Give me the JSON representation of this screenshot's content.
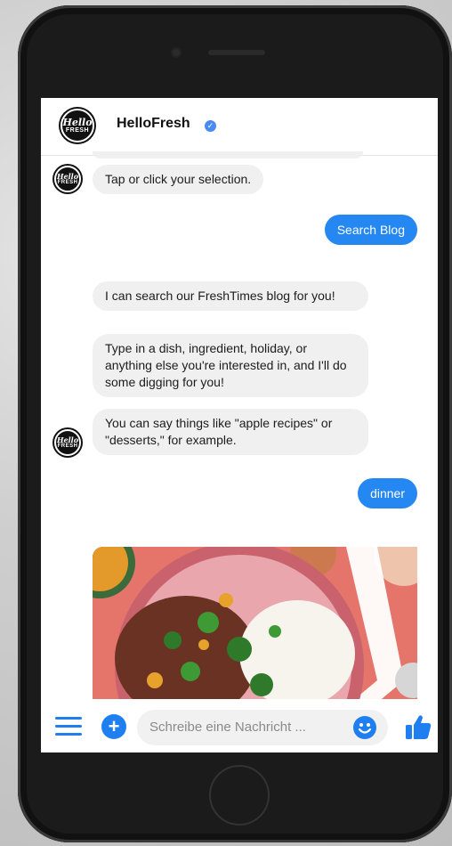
{
  "header": {
    "title": "HelloFresh",
    "verified_mark": "✓"
  },
  "brand_logo": {
    "line1": "Hello",
    "line2": "FRESH"
  },
  "messages": {
    "prompt": "Tap or click your selection.",
    "choice_search_blog": "Search Blog",
    "intro": "I can search our FreshTimes blog for you!",
    "instruction": "Type in a dish, ingredient, holiday, or anything else you're interested in, and I'll do some digging for you!",
    "example": "You can say things like \"apple recipes\" or \"desserts,\" for example.",
    "user_query": "dinner"
  },
  "composer": {
    "placeholder": "Schreibe eine Nachricht ..."
  },
  "icons": {
    "menu": "menu-icon",
    "plus": "plus-icon",
    "emoji": "emoji-icon",
    "like": "thumbs-up-icon",
    "verified": "verified-badge-icon"
  },
  "colors": {
    "accent": "#1f7ff0",
    "bubble_out": "#2487f2",
    "bubble_in": "#f0f0f0"
  }
}
